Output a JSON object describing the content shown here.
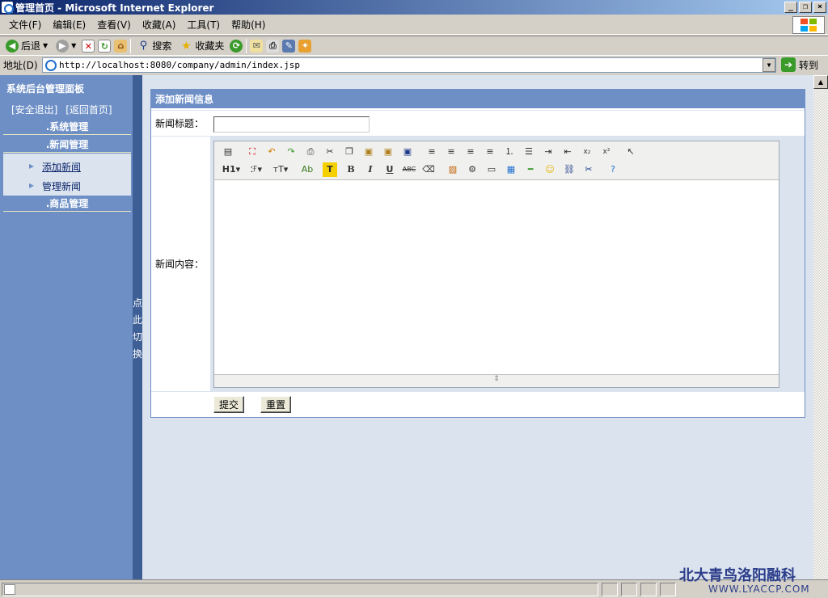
{
  "window": {
    "title": "管理首页 - Microsoft Internet Explorer"
  },
  "menu": [
    "文件(F)",
    "编辑(E)",
    "查看(V)",
    "收藏(A)",
    "工具(T)",
    "帮助(H)"
  ],
  "toolbar": {
    "back": "后退",
    "search": "搜索",
    "favorites": "收藏夹"
  },
  "address": {
    "label": "地址(D)",
    "url": "http://localhost:8080/company/admin/index.jsp",
    "go": "转到"
  },
  "sidebar": {
    "title": "系统后台管理面板",
    "logout": "[安全退出]",
    "home": "[返回首页]",
    "sections": [
      ".系统管理",
      ".新闻管理",
      ".商品管理"
    ],
    "news_items": [
      "添加新闻",
      "管理新闻"
    ],
    "toggle": [
      "点",
      "此",
      "切",
      "换"
    ]
  },
  "form": {
    "heading": "添加新闻信息",
    "title_label": "新闻标题：",
    "title_value": "",
    "content_label": "新闻内容：",
    "submit": "提交",
    "reset": "重置"
  },
  "watermark": {
    "line1": "北大青鸟洛阳融科",
    "line2": "WWW.LYACCP.COM"
  }
}
